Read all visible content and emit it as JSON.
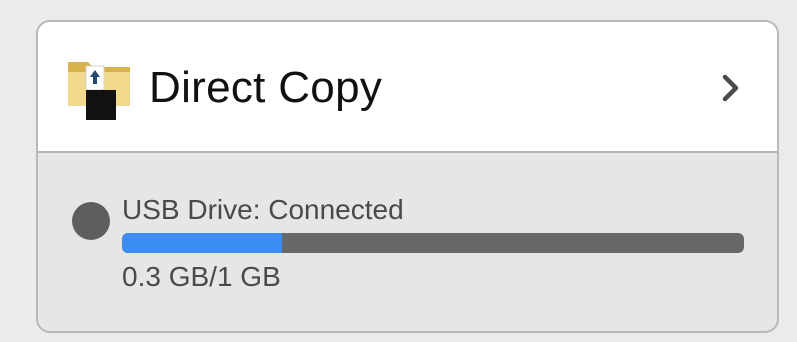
{
  "header": {
    "title": "Direct Copy",
    "icon": "usb-folder-icon",
    "action_icon": "chevron-right-icon"
  },
  "status": {
    "indicator_icon": "status-dot-icon",
    "label": "USB Drive: Connected",
    "usage_text": "0.3 GB/1 GB",
    "used_fraction": 0.3,
    "colors": {
      "progress_fill": "#3c8df1",
      "progress_track": "#686868",
      "status_dot": "#5e5e5e"
    }
  }
}
